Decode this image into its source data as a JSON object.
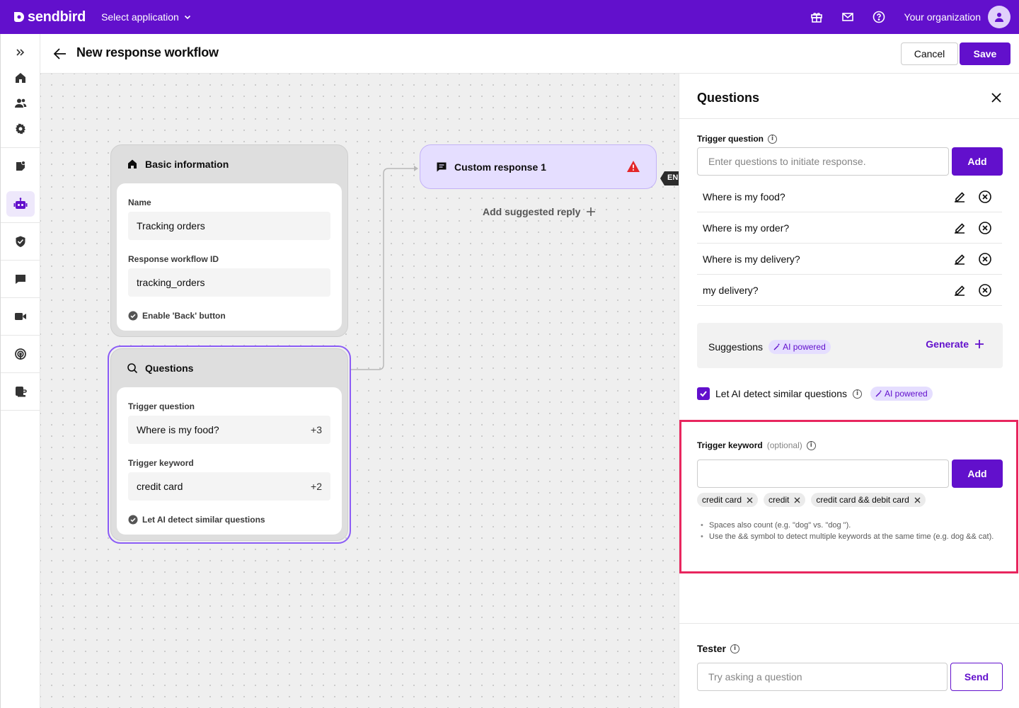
{
  "brand": {
    "name": "sendbird",
    "accent": "#6210cc"
  },
  "topbar": {
    "app_select": "Select application",
    "organization": "Your organization"
  },
  "header": {
    "title": "New response workflow",
    "cancel_label": "Cancel",
    "save_label": "Save"
  },
  "canvas": {
    "basic_info": {
      "title": "Basic information",
      "name_label": "Name",
      "name_value": "Tracking orders",
      "id_label": "Response workflow ID",
      "id_value": "tracking_orders",
      "back_button": "Enable 'Back' button"
    },
    "questions": {
      "title": "Questions",
      "trigger_question_label": "Trigger question",
      "trigger_question_value": "Where is my food?",
      "trigger_question_more": "+3",
      "trigger_keyword_label": "Trigger keyword",
      "trigger_keyword_value": "credit card",
      "trigger_keyword_more": "+2",
      "ai_detect": "Let AI detect similar questions"
    },
    "custom_response": {
      "title": "Custom response 1"
    },
    "end_tag": "END",
    "add_suggested_reply": "Add suggested reply"
  },
  "panel": {
    "title": "Questions",
    "trigger_question_label": "Trigger question",
    "trigger_question_placeholder": "Enter questions to initiate response.",
    "add_label": "Add",
    "questions": [
      "Where is my food?",
      "Where is my order?",
      "Where is my delivery?",
      "my delivery?"
    ],
    "suggestions_label": "Suggestions",
    "ai_powered": "AI powered",
    "generate_label": "Generate",
    "ai_detect_label": "Let AI detect similar questions",
    "trigger_keyword_label": "Trigger keyword",
    "trigger_keyword_optional": "(optional)",
    "keyword_chips": [
      "credit card",
      "credit",
      "credit card && debit card"
    ],
    "notes": [
      "Spaces also count (e.g. \"dog\" vs. \"dog \").",
      "Use the && symbol to detect multiple keywords at the same time (e.g. dog && cat)."
    ],
    "tester_label": "Tester",
    "tester_placeholder": "Try asking a question",
    "send_label": "Send"
  }
}
